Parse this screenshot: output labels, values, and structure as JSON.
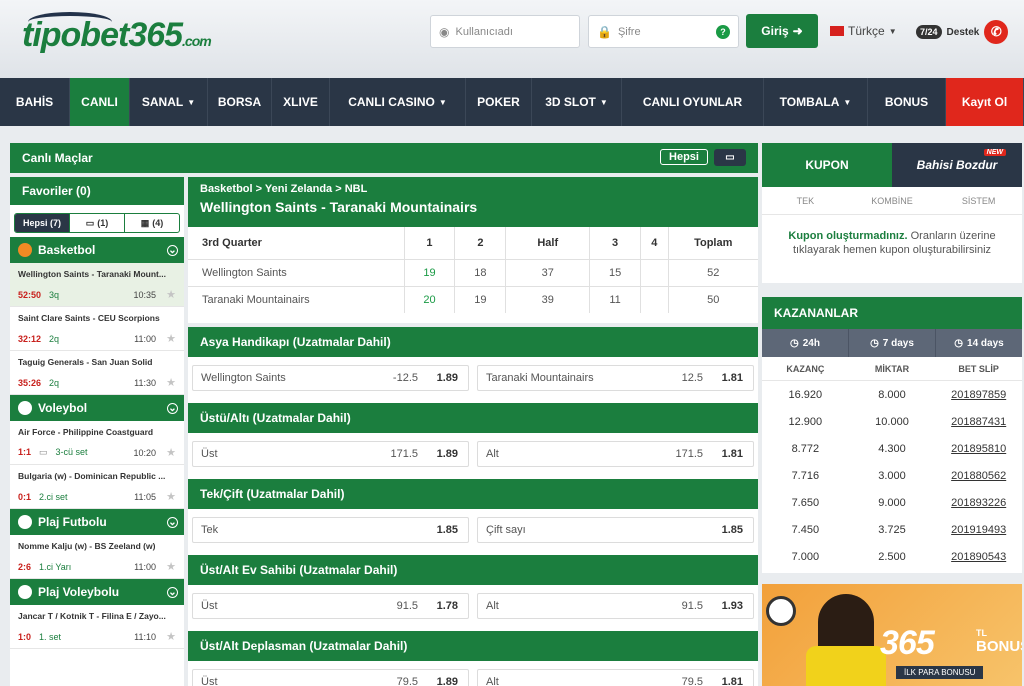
{
  "header": {
    "logo_text": "tipobet",
    "logo_num": "365",
    "logo_domain": ".com",
    "username_placeholder": "Kullanıcıadı",
    "password_placeholder": "Şifre",
    "login_label": "Giriş",
    "language": "Türkçe",
    "support_badge": "7/24",
    "support_label": "Destek"
  },
  "nav": {
    "items": [
      {
        "label": "BAHİS"
      },
      {
        "label": "CANLI"
      },
      {
        "label": "SANAL"
      },
      {
        "label": "BORSA"
      },
      {
        "label": "XLIVE"
      },
      {
        "label": "CANLI CASINO"
      },
      {
        "label": "POKER"
      },
      {
        "label": "3D SLOT"
      },
      {
        "label": "CANLI OYUNLAR"
      },
      {
        "label": "TOMBALA"
      },
      {
        "label": "BONUS"
      },
      {
        "label": "Kayıt Ol"
      }
    ]
  },
  "live": {
    "title": "Canlı Maçlar",
    "all_button": "Hepsi"
  },
  "sidebar": {
    "favorites": "Favoriler (0)",
    "filters": [
      "Hepsi (7)",
      "(1)",
      "(4)"
    ],
    "sports": [
      {
        "name": "Basketbol",
        "matches": [
          {
            "teams": "Wellington Saints - Taranaki Mount...",
            "score": "52:50",
            "period": "3q",
            "time": "10:35"
          },
          {
            "teams": "Saint Clare Saints - CEU Scorpions",
            "score": "32:12",
            "period": "2q",
            "time": "11:00"
          },
          {
            "teams": "Taguig Generals - San Juan Solid",
            "score": "35:26",
            "period": "2q",
            "time": "11:30"
          }
        ]
      },
      {
        "name": "Voleybol",
        "matches": [
          {
            "teams": "Air Force - Philippine Coastguard",
            "score": "1:1",
            "period": "3-cü set",
            "time": "10:20"
          },
          {
            "teams": "Bulgaria (w) - Dominican Republic ...",
            "score": "0:1",
            "period": "2.ci set",
            "time": "11:05"
          }
        ]
      },
      {
        "name": "Plaj Futbolu",
        "matches": [
          {
            "teams": "Nomme Kalju (w) - BS Zeeland (w)",
            "score": "2:6",
            "period": "1.ci Yarı",
            "time": "11:00"
          }
        ]
      },
      {
        "name": "Plaj Voleybolu",
        "matches": [
          {
            "teams": "Jancar T / Kotnik T - Filina E / Zayo...",
            "score": "1:0",
            "period": "1. set",
            "time": "11:10"
          }
        ]
      }
    ]
  },
  "match": {
    "breadcrumb": [
      "Basketbol",
      "Yeni Zelanda",
      "NBL"
    ],
    "title": "Wellington Saints - Taranaki Mountainairs",
    "score_headers": [
      "3rd Quarter",
      "1",
      "2",
      "Half",
      "3",
      "4",
      "Toplam"
    ],
    "score_rows": [
      [
        "Wellington Saints",
        "19",
        "18",
        "37",
        "15",
        "",
        "52"
      ],
      [
        "Taranaki Mountainairs",
        "20",
        "19",
        "39",
        "11",
        "",
        "50"
      ]
    ]
  },
  "markets": [
    {
      "title": "Asya Handikapı (Uzatmalar Dahil)",
      "odds": [
        {
          "label": "Wellington Saints",
          "line": "-12.5",
          "value": "1.89"
        },
        {
          "label": "Taranaki Mountainairs",
          "line": "12.5",
          "value": "1.81"
        }
      ]
    },
    {
      "title": "Üstü/Altı (Uzatmalar Dahil)",
      "odds": [
        {
          "label": "Üst",
          "line": "171.5",
          "value": "1.89"
        },
        {
          "label": "Alt",
          "line": "171.5",
          "value": "1.81"
        }
      ]
    },
    {
      "title": "Tek/Çift (Uzatmalar Dahil)",
      "odds": [
        {
          "label": "Tek",
          "line": "",
          "value": "1.85"
        },
        {
          "label": "Çift sayı",
          "line": "",
          "value": "1.85"
        }
      ]
    },
    {
      "title": "Üst/Alt Ev Sahibi (Uzatmalar Dahil)",
      "odds": [
        {
          "label": "Üst",
          "line": "91.5",
          "value": "1.78"
        },
        {
          "label": "Alt",
          "line": "91.5",
          "value": "1.93"
        }
      ]
    },
    {
      "title": "Üst/Alt Deplasman  (Uzatmalar Dahil)",
      "odds": [
        {
          "label": "Üst",
          "line": "79.5",
          "value": "1.89"
        },
        {
          "label": "Alt",
          "line": "79.5",
          "value": "1.81"
        }
      ]
    }
  ],
  "coupon": {
    "tab1": "KUPON",
    "tab2": "Bahisi Bozdur",
    "new_badge": "NEW",
    "types": [
      "TEK",
      "KOMBİNE",
      "SİSTEM"
    ],
    "message_bold": "Kupon oluşturmadınız.",
    "message_rest": " Oranların üzerine tıklayarak hemen kupon oluşturabilirsiniz"
  },
  "winners": {
    "title": "KAZANANLAR",
    "tabs": [
      "24h",
      "7 days",
      "14 days"
    ],
    "columns": [
      "KAZANÇ",
      "MİKTAR",
      "BET SLİP"
    ],
    "rows": [
      [
        "16.920",
        "8.000",
        "201897859"
      ],
      [
        "12.900",
        "10.000",
        "201887431"
      ],
      [
        "8.772",
        "4.300",
        "201895810"
      ],
      [
        "7.716",
        "3.000",
        "201880562"
      ],
      [
        "7.650",
        "9.000",
        "201893226"
      ],
      [
        "7.450",
        "3.725",
        "201919493"
      ],
      [
        "7.000",
        "2.500",
        "201890543"
      ]
    ]
  },
  "banner": {
    "amount": "365",
    "currency": "TL",
    "bonus": "BONUS",
    "subtitle": "İLK PARA BONUSU"
  },
  "colors": {
    "green": "#1b7e3e",
    "navy": "#2a3646",
    "red": "#e0271c"
  }
}
